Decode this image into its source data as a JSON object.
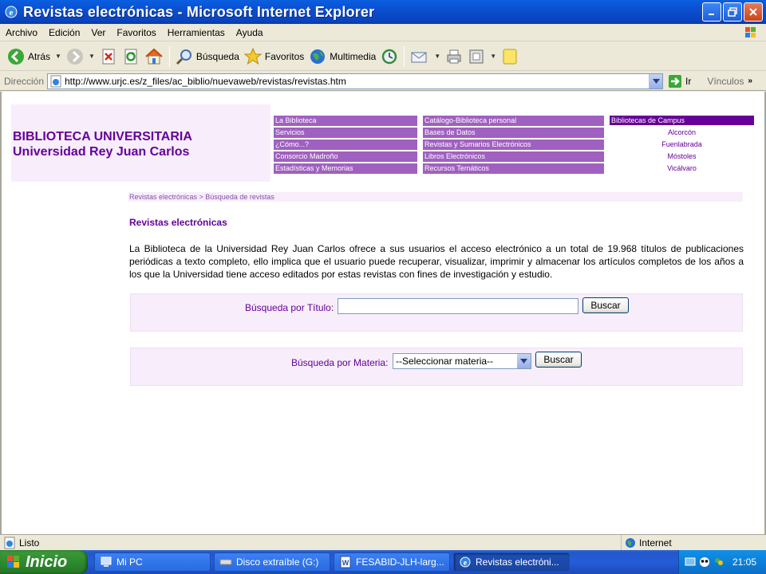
{
  "window": {
    "title": "Revistas electrónicas - Microsoft Internet Explorer"
  },
  "menu": [
    "Archivo",
    "Edición",
    "Ver",
    "Favoritos",
    "Herramientas",
    "Ayuda"
  ],
  "toolbar": {
    "back": "Atrás",
    "search": "Búsqueda",
    "favorites": "Favoritos",
    "multimedia": "Multimedia"
  },
  "address": {
    "label": "Dirección",
    "url": "http://www.urjc.es/z_files/ac_biblio/nuevaweb/revistas/revistas.htm",
    "go": "Ir",
    "links": "Vínculos"
  },
  "header": {
    "line1": "BIBLIOTECA UNIVERSITARIA",
    "line2": "Universidad Rey Juan Carlos"
  },
  "nav": {
    "col1": [
      "La Biblioteca",
      "Servicios",
      "¿Cómo...?",
      "Consorcio Madroño",
      "Estadísticas y Memorias"
    ],
    "col2": [
      "Catálogo-Biblioteca personal",
      "Bases de Datos",
      "Revistas y Sumarios Electrónicos",
      "Libros Electrónicos",
      "Recursos Temáticos"
    ]
  },
  "campus": {
    "heading": "Bibliotecas de Campus",
    "items": [
      "Alcorcón",
      "Fuenlabrada",
      "Móstoles",
      "Vicálvaro"
    ]
  },
  "breadcrumb": "Revistas electrónicas > Búsqueda de revistas",
  "page_title": "Revistas electrónicas",
  "intro": "La Biblioteca de la Universidad Rey Juan Carlos ofrece a sus usuarios el acceso electrónico a un total de 19.968 títulos de publicaciones periódicas a texto completo, ello implica que el usuario puede recuperar, visualizar, imprimir y almacenar los artículos completos de los años a los que la Universidad tiene acceso editados por estas revistas con fines de investigación y estudio.",
  "search_title": {
    "label": "Búsqueda por Título:",
    "value": "",
    "button": "Buscar"
  },
  "search_subject": {
    "label": "Búsqueda por Materia:",
    "selected": "--Seleccionar materia--",
    "button": "Buscar"
  },
  "status": {
    "left": "Listo",
    "zone": "Internet"
  },
  "taskbar": {
    "start": "Inicio",
    "tasks": [
      "Mi PC",
      "Disco extraíble (G:)",
      "FESABID-JLH-larg...",
      "Revistas electróni..."
    ],
    "clock": "21:05"
  }
}
